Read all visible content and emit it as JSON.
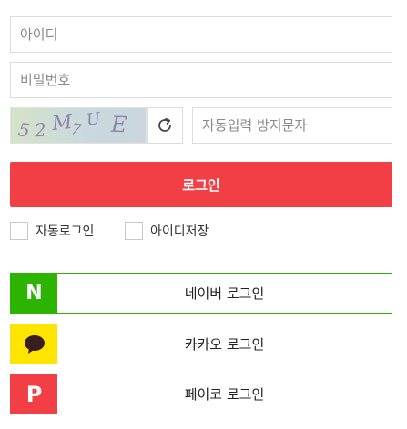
{
  "login_form": {
    "id_placeholder": "아이디",
    "password_placeholder": "비밀번호",
    "captcha": {
      "chars": [
        "5",
        "2",
        "M",
        "7",
        "U",
        "E"
      ],
      "input_placeholder": "자동입력 방지문자",
      "refresh_icon": "refresh-icon"
    },
    "login_button": "로그인",
    "auto_login_label": "자동로그인",
    "save_id_label": "아이디저장"
  },
  "social_login": [
    {
      "id": "naver",
      "label": "네이버 로그인",
      "icon": "naver-n-icon",
      "icon_text": "N",
      "color": "#2db400"
    },
    {
      "id": "kakao",
      "label": "카카오 로그인",
      "icon": "kakao-talk-icon",
      "color": "#fee500"
    },
    {
      "id": "payco",
      "label": "페이코 로그인",
      "icon": "payco-p-icon",
      "icon_text": "P",
      "color": "#f23f46"
    }
  ],
  "colors": {
    "accent": "#f23f46",
    "naver": "#2db400",
    "kakao": "#fee500",
    "payco": "#f23f46",
    "border": "#dcdcdc"
  }
}
